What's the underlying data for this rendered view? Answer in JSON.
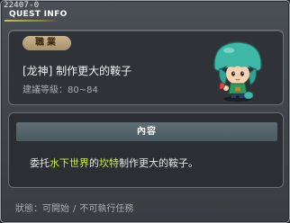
{
  "window": {
    "quest_id": "22407-0",
    "title": "QUEST INFO"
  },
  "quest": {
    "category": "職業",
    "name": "[龙神]  制作更大的鞍子",
    "level_label": "建議等級：",
    "level_range": "80~84",
    "npc": "water-mushroom-kid"
  },
  "content": {
    "header": "內容",
    "desc_part1": "委托",
    "desc_place": "水下世界",
    "desc_part2": "的",
    "desc_npc": "坎特",
    "desc_part3": "制作更大的鞍子。"
  },
  "status": {
    "label": "狀態：",
    "value1": "可開始",
    "separator": "/",
    "value2": "不可執行任務"
  },
  "colors": {
    "highlight": "#c9f03a",
    "badge": "#b8a07a",
    "content_header": "#56656e"
  }
}
